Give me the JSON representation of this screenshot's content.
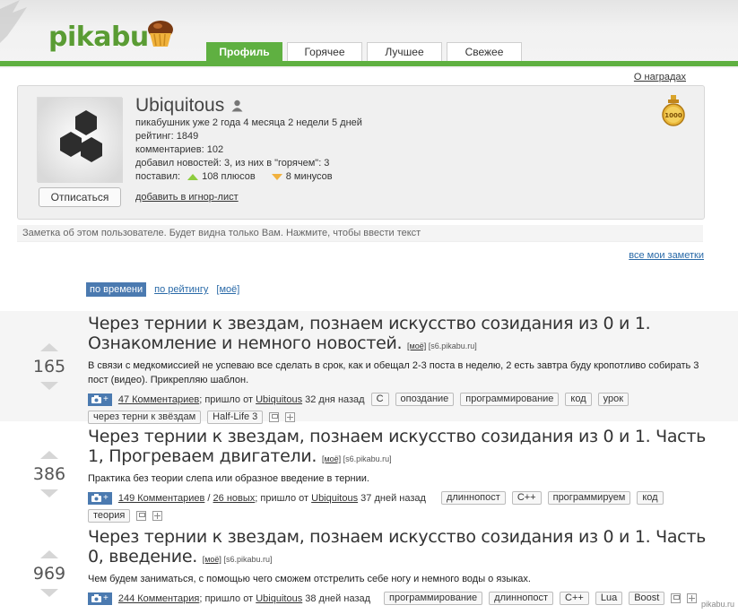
{
  "header": {
    "logo_text": "pikabu",
    "tabs": [
      {
        "label": "Профиль",
        "active": true
      },
      {
        "label": "Горячее",
        "active": false
      },
      {
        "label": "Лучшее",
        "active": false
      },
      {
        "label": "Свежее",
        "active": false
      }
    ],
    "accent_color": "#5fb041"
  },
  "awards_link": "О наградах",
  "profile": {
    "username": "Ubiquitous",
    "lines": [
      "пикабушник уже 2 года 4 месяца 2 недели 5 дней",
      "рейтинг: 1849",
      "комментариев: 102",
      "добавил новостей: 3, из них в \"горячем\": 3"
    ],
    "votes_label": "поставил:",
    "plus": "108 плюсов",
    "minus": "8 минусов",
    "unsubscribe_label": "Отписаться",
    "ignore_label": "добавить в игнор-лист",
    "medal_text": "1000"
  },
  "note_placeholder": "Заметка об этом пользователе. Будет видна только Вам. Нажмите, чтобы ввести текст",
  "all_notes_link": "все мои заметки",
  "sort": {
    "active": "по времени",
    "rating": "по рейтингу",
    "mine": "[моё]"
  },
  "posts": [
    {
      "score": "165",
      "title": "Через тернии к звездам, познаем искусство созидания из 0 и 1. Ознакомление и немного новостей.",
      "meta_mine": "[моё]",
      "meta_src": "[s6.pikabu.ru]",
      "desc": "В связи с медкомиссией не успеваю все сделать в срок, как и обещал 2-3 поста в неделю, 2 есть завтра буду кропотливо собирать 3 пост (видео). Прикрепляю шаблон.",
      "comments": "47 Комментариев",
      "new_comments": "",
      "from_prefix": "; пришло от",
      "author": "Ubiquitous",
      "age": "32 дня назад",
      "tags": [
        "C",
        "опоздание",
        "программирование",
        "код",
        "урок",
        "через терни к звёздам",
        "Half-Life 3"
      ]
    },
    {
      "score": "386",
      "title": "Через тернии к звездам, познаем искусство созидания из 0 и 1. Часть 1, Прогреваем двигатели.",
      "meta_mine": "[моё]",
      "meta_src": "[s6.pikabu.ru]",
      "desc": "Практика без теории слепа или образное введение в тернии.",
      "comments": "149 Комментариев",
      "new_comments": "26 новых",
      "from_prefix": "; пришло от",
      "author": "Ubiquitous",
      "age": "37 дней назад",
      "tags": [
        "длиннопост",
        "C++",
        "программируем",
        "код",
        "теория"
      ]
    },
    {
      "score": "969",
      "title": "Через тернии к звездам, познаем искусство созидания из 0 и 1. Часть 0, введение.",
      "meta_mine": "[моё]",
      "meta_src": "[s6.pikabu.ru]",
      "desc": "Чем будем заниматься, с помощью чего сможем отстрелить себе ногу и немного воды о языках.",
      "comments": "244 Комментария",
      "new_comments": "",
      "from_prefix": "; пришло от",
      "author": "Ubiquitous",
      "age": "38 дней назад",
      "tags": [
        "программирование",
        "длиннопост",
        "C++",
        "Lua",
        "Boost"
      ]
    }
  ],
  "camera_plus": "+",
  "watermark": "pikabu.ru"
}
